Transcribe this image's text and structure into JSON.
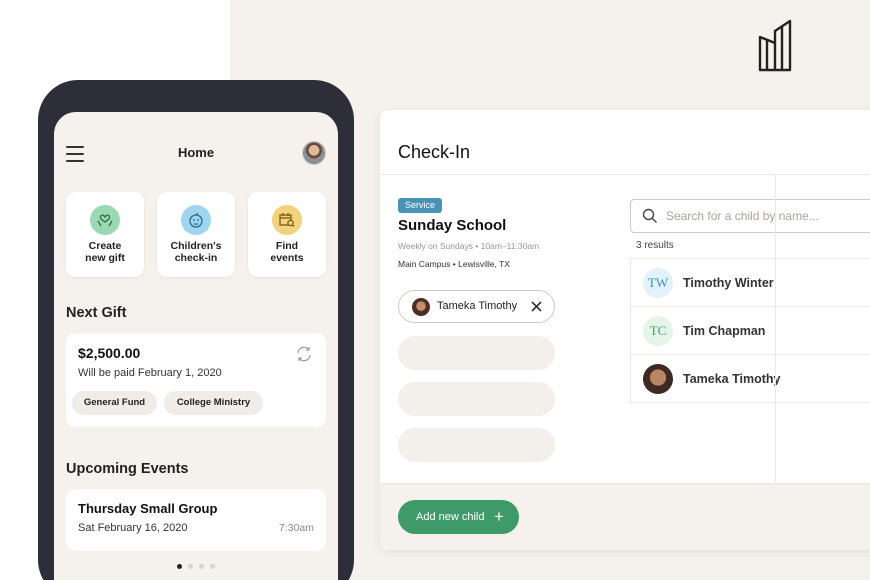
{
  "phone": {
    "header_title": "Home",
    "tiles": [
      {
        "label": "Create\nnew gift",
        "icon": "gift-hands-icon",
        "color": "#9bd9b3"
      },
      {
        "label": "Children's\ncheck-in",
        "icon": "child-face-icon",
        "color": "#9fd5f0"
      },
      {
        "label": "Find\nevents",
        "icon": "calendar-search-icon",
        "color": "#f3d27c"
      }
    ],
    "next_gift": {
      "heading": "Next Gift",
      "amount": "$2,500.00",
      "subtitle": "Will be paid February 1, 2020",
      "funds": [
        "General Fund",
        "College Ministry"
      ]
    },
    "events": {
      "heading": "Upcoming Events",
      "items": [
        {
          "title": "Thursday Small Group",
          "date": "Sat February 16, 2020",
          "time": "7:30am"
        }
      ]
    },
    "carousel": {
      "active": 0,
      "count": 4
    }
  },
  "checkin": {
    "title": "Check-In",
    "service": {
      "badge": "Service",
      "name": "Sunday School",
      "schedule": "Weekly on Sundays • 10am–11:30am",
      "location": "Main Campus •  Lewisville, TX"
    },
    "selected_child": "Tameka Timothy",
    "search": {
      "placeholder": "Search for a child by name...",
      "value": ""
    },
    "results_count": "3 results",
    "results": [
      {
        "name": "Timothy Winter",
        "initials": "TW",
        "bg": "#e3f2fa",
        "fg": "#3a8fb7"
      },
      {
        "name": "Tim Chapman",
        "initials": "TC",
        "bg": "#e6f5ea",
        "fg": "#3f9a6a"
      },
      {
        "name": "Tameka Timothy",
        "initials": "",
        "bg": "",
        "fg": ""
      }
    ],
    "add_button": "Add new child",
    "accent": "#3f9a6a",
    "badge_color": "#4a93b6"
  }
}
